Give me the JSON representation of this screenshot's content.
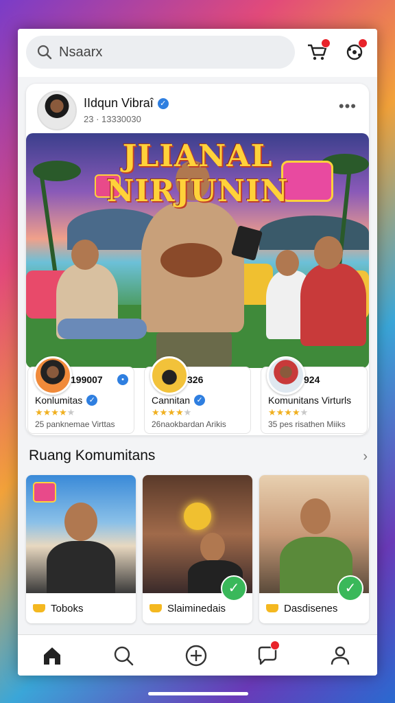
{
  "search": {
    "value": "Nsaarx"
  },
  "colors": {
    "accent": "#2f7fe0",
    "badge": "#e8232a",
    "check": "#3ab85a"
  },
  "header_icons": {
    "cart": "cart-icon",
    "settings": "settings-icon"
  },
  "post": {
    "author": "IIdqun Vibraî",
    "id": "23 · 13330030",
    "banner_title": "JLIANAL NIRJUNIN"
  },
  "stats": [
    {
      "count": "199007",
      "name": "Konlumitas",
      "rating": 4,
      "desc": "25 panknemae Virttas"
    },
    {
      "count": "326",
      "name": "Cannitan",
      "rating": 4,
      "desc": "26naokbardan Arikis"
    },
    {
      "count": "924",
      "name": "Komunitans Virturls",
      "rating": 4,
      "desc": "35 pes risathen Miiks"
    }
  ],
  "section": {
    "title": "Ruang Komumitans"
  },
  "rooms": [
    {
      "label": "Toboks",
      "checked": false
    },
    {
      "label": "Slaiminedais",
      "checked": true
    },
    {
      "label": "Dasdisenes",
      "checked": true
    }
  ],
  "nav": [
    "home-icon",
    "search-icon",
    "add-icon",
    "chat-icon",
    "profile-icon"
  ]
}
